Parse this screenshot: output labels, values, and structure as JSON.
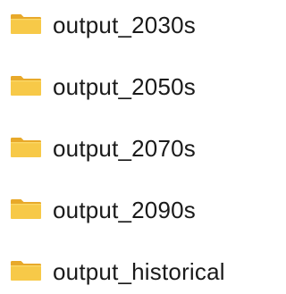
{
  "folders": [
    {
      "name": "output_2030s",
      "icon": "folder-icon",
      "color": "#F7C948"
    },
    {
      "name": "output_2050s",
      "icon": "folder-icon",
      "color": "#F7C948"
    },
    {
      "name": "output_2070s",
      "icon": "folder-icon",
      "color": "#F7C948"
    },
    {
      "name": "output_2090s",
      "icon": "folder-icon",
      "color": "#F7C948"
    },
    {
      "name": "output_historical",
      "icon": "folder-icon",
      "color": "#F7C948"
    }
  ]
}
